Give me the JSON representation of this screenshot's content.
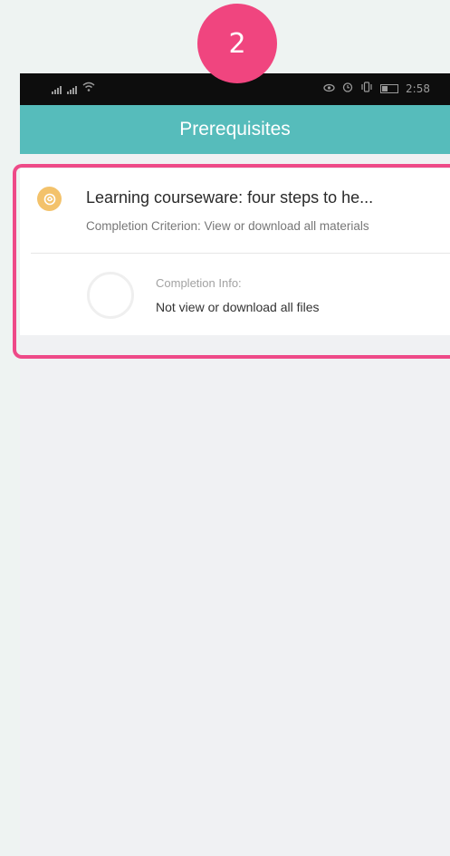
{
  "step_number": "2",
  "status_bar": {
    "time": "2:58",
    "icons": [
      "signal-icon",
      "signal-icon",
      "wifi-icon",
      "eye-icon",
      "alarm-icon",
      "vibrate-icon",
      "battery-icon"
    ]
  },
  "app_bar": {
    "title": "Prerequisites"
  },
  "prerequisite": {
    "title": "Learning courseware: four steps to he...",
    "criterion": "Completion Criterion: View or download all materials",
    "completion_info_label": "Completion Info:",
    "completion_info_value": "Not view or download all files",
    "progress": 0
  },
  "colors": {
    "accent": "#56bcbb",
    "highlight": "#ee4a88",
    "badge": "#f0457f",
    "course_icon": "#f3c26b"
  }
}
